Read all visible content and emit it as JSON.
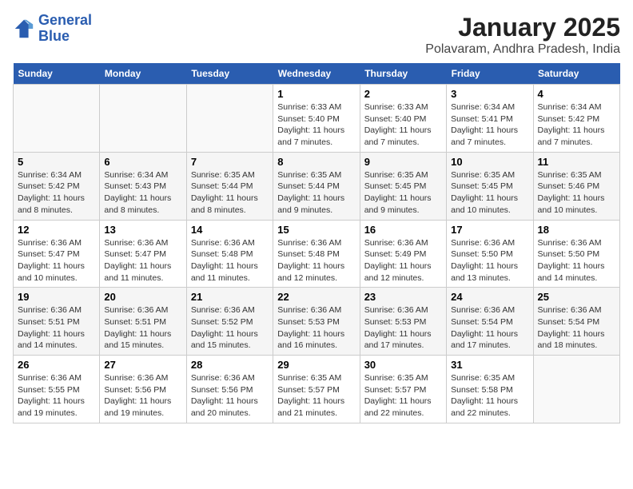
{
  "logo": {
    "line1": "General",
    "line2": "Blue"
  },
  "header": {
    "month": "January 2025",
    "location": "Polavaram, Andhra Pradesh, India"
  },
  "weekdays": [
    "Sunday",
    "Monday",
    "Tuesday",
    "Wednesday",
    "Thursday",
    "Friday",
    "Saturday"
  ],
  "weeks": [
    [
      {
        "day": "",
        "info": ""
      },
      {
        "day": "",
        "info": ""
      },
      {
        "day": "",
        "info": ""
      },
      {
        "day": "1",
        "info": "Sunrise: 6:33 AM\nSunset: 5:40 PM\nDaylight: 11 hours\nand 7 minutes."
      },
      {
        "day": "2",
        "info": "Sunrise: 6:33 AM\nSunset: 5:40 PM\nDaylight: 11 hours\nand 7 minutes."
      },
      {
        "day": "3",
        "info": "Sunrise: 6:34 AM\nSunset: 5:41 PM\nDaylight: 11 hours\nand 7 minutes."
      },
      {
        "day": "4",
        "info": "Sunrise: 6:34 AM\nSunset: 5:42 PM\nDaylight: 11 hours\nand 7 minutes."
      }
    ],
    [
      {
        "day": "5",
        "info": "Sunrise: 6:34 AM\nSunset: 5:42 PM\nDaylight: 11 hours\nand 8 minutes."
      },
      {
        "day": "6",
        "info": "Sunrise: 6:34 AM\nSunset: 5:43 PM\nDaylight: 11 hours\nand 8 minutes."
      },
      {
        "day": "7",
        "info": "Sunrise: 6:35 AM\nSunset: 5:44 PM\nDaylight: 11 hours\nand 8 minutes."
      },
      {
        "day": "8",
        "info": "Sunrise: 6:35 AM\nSunset: 5:44 PM\nDaylight: 11 hours\nand 9 minutes."
      },
      {
        "day": "9",
        "info": "Sunrise: 6:35 AM\nSunset: 5:45 PM\nDaylight: 11 hours\nand 9 minutes."
      },
      {
        "day": "10",
        "info": "Sunrise: 6:35 AM\nSunset: 5:45 PM\nDaylight: 11 hours\nand 10 minutes."
      },
      {
        "day": "11",
        "info": "Sunrise: 6:35 AM\nSunset: 5:46 PM\nDaylight: 11 hours\nand 10 minutes."
      }
    ],
    [
      {
        "day": "12",
        "info": "Sunrise: 6:36 AM\nSunset: 5:47 PM\nDaylight: 11 hours\nand 10 minutes."
      },
      {
        "day": "13",
        "info": "Sunrise: 6:36 AM\nSunset: 5:47 PM\nDaylight: 11 hours\nand 11 minutes."
      },
      {
        "day": "14",
        "info": "Sunrise: 6:36 AM\nSunset: 5:48 PM\nDaylight: 11 hours\nand 11 minutes."
      },
      {
        "day": "15",
        "info": "Sunrise: 6:36 AM\nSunset: 5:48 PM\nDaylight: 11 hours\nand 12 minutes."
      },
      {
        "day": "16",
        "info": "Sunrise: 6:36 AM\nSunset: 5:49 PM\nDaylight: 11 hours\nand 12 minutes."
      },
      {
        "day": "17",
        "info": "Sunrise: 6:36 AM\nSunset: 5:50 PM\nDaylight: 11 hours\nand 13 minutes."
      },
      {
        "day": "18",
        "info": "Sunrise: 6:36 AM\nSunset: 5:50 PM\nDaylight: 11 hours\nand 14 minutes."
      }
    ],
    [
      {
        "day": "19",
        "info": "Sunrise: 6:36 AM\nSunset: 5:51 PM\nDaylight: 11 hours\nand 14 minutes."
      },
      {
        "day": "20",
        "info": "Sunrise: 6:36 AM\nSunset: 5:51 PM\nDaylight: 11 hours\nand 15 minutes."
      },
      {
        "day": "21",
        "info": "Sunrise: 6:36 AM\nSunset: 5:52 PM\nDaylight: 11 hours\nand 15 minutes."
      },
      {
        "day": "22",
        "info": "Sunrise: 6:36 AM\nSunset: 5:53 PM\nDaylight: 11 hours\nand 16 minutes."
      },
      {
        "day": "23",
        "info": "Sunrise: 6:36 AM\nSunset: 5:53 PM\nDaylight: 11 hours\nand 17 minutes."
      },
      {
        "day": "24",
        "info": "Sunrise: 6:36 AM\nSunset: 5:54 PM\nDaylight: 11 hours\nand 17 minutes."
      },
      {
        "day": "25",
        "info": "Sunrise: 6:36 AM\nSunset: 5:54 PM\nDaylight: 11 hours\nand 18 minutes."
      }
    ],
    [
      {
        "day": "26",
        "info": "Sunrise: 6:36 AM\nSunset: 5:55 PM\nDaylight: 11 hours\nand 19 minutes."
      },
      {
        "day": "27",
        "info": "Sunrise: 6:36 AM\nSunset: 5:56 PM\nDaylight: 11 hours\nand 19 minutes."
      },
      {
        "day": "28",
        "info": "Sunrise: 6:36 AM\nSunset: 5:56 PM\nDaylight: 11 hours\nand 20 minutes."
      },
      {
        "day": "29",
        "info": "Sunrise: 6:35 AM\nSunset: 5:57 PM\nDaylight: 11 hours\nand 21 minutes."
      },
      {
        "day": "30",
        "info": "Sunrise: 6:35 AM\nSunset: 5:57 PM\nDaylight: 11 hours\nand 22 minutes."
      },
      {
        "day": "31",
        "info": "Sunrise: 6:35 AM\nSunset: 5:58 PM\nDaylight: 11 hours\nand 22 minutes."
      },
      {
        "day": "",
        "info": ""
      }
    ]
  ]
}
